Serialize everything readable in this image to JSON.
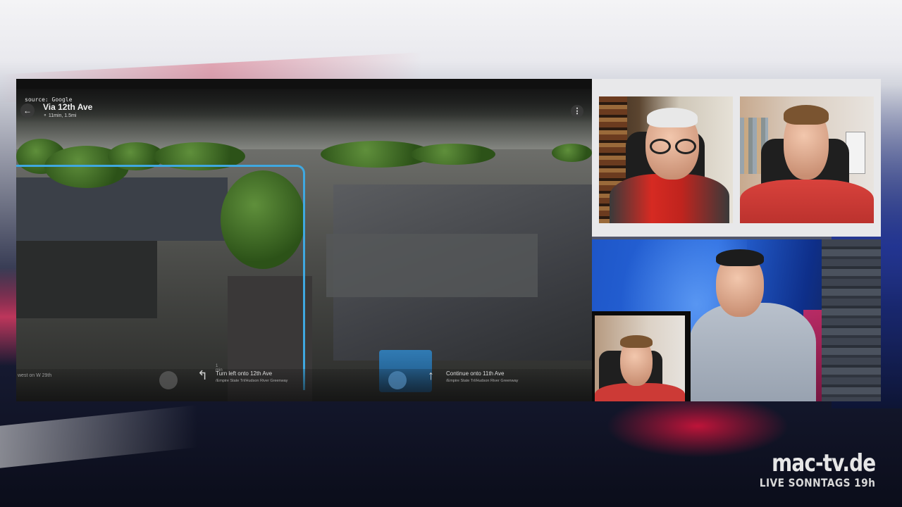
{
  "map": {
    "source": "source: Google",
    "back_icon": "arrow-left-icon",
    "route_title": "Via 12th Ave",
    "route_meta": "11min, 1.5mi",
    "menu_icon": "more-vertical-icon",
    "route_color": "#3fa8e0",
    "steps": [
      {
        "instruction": "west on W 29th"
      },
      {
        "distance": "1 min",
        "instruction": "Turn left onto 12th Ave",
        "sub": "/Empire State Trl/Hudson River Greenway"
      },
      {
        "distance": "",
        "instruction": "Continue onto 11th Ave",
        "sub": "/Empire State Trl/Hudson River Greenway"
      }
    ]
  },
  "brand": {
    "name": "mac-tv.de",
    "tagline": "LIVE SONNTAGS 19h"
  }
}
